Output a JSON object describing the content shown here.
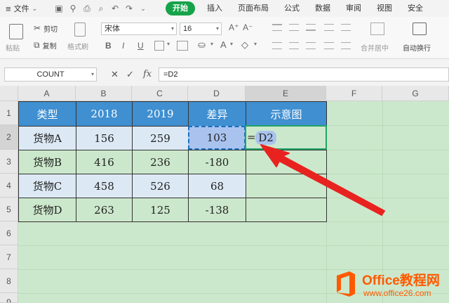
{
  "menu": {
    "file_label": "文件",
    "tabs": [
      "开始",
      "插入",
      "页面布局",
      "公式",
      "数据",
      "审阅",
      "视图",
      "安全"
    ]
  },
  "ribbon": {
    "paste": "粘贴",
    "cut": "剪切",
    "copy": "复制",
    "format_painter": "格式刷",
    "font_name": "宋体",
    "font_size": "16",
    "merge_center": "合并居中",
    "wrap_text": "自动换行"
  },
  "formula_bar": {
    "name_box": "COUNT",
    "cancel_icon": "✕",
    "confirm_icon": "✓",
    "fx_label": "fx",
    "formula": "=D2"
  },
  "grid": {
    "columns": [
      "A",
      "B",
      "C",
      "D",
      "E",
      "F",
      "G"
    ],
    "rows": [
      "1",
      "2",
      "3",
      "4",
      "5",
      "6",
      "7",
      "8",
      "9"
    ],
    "table": {
      "headers": [
        "类型",
        "2018",
        "2019",
        "差异",
        "示意图"
      ],
      "rows": [
        [
          "货物A",
          "156",
          "259",
          "103",
          ""
        ],
        [
          "货物B",
          "416",
          "236",
          "-180",
          ""
        ],
        [
          "货物C",
          "458",
          "526",
          "68",
          ""
        ],
        [
          "货物D",
          "263",
          "125",
          "-138",
          ""
        ]
      ]
    },
    "editing_cell": {
      "equals": "=",
      "ref": "D2"
    }
  },
  "watermark": {
    "title": "Office教程网",
    "url": "www.office26.com"
  },
  "colors": {
    "header_blue": "#3f8fd1",
    "tab_active": "#16a34a",
    "sheet_green": "#cce8cc",
    "arrow_red": "#e8231f",
    "watermark_orange": "#ff5a00"
  }
}
